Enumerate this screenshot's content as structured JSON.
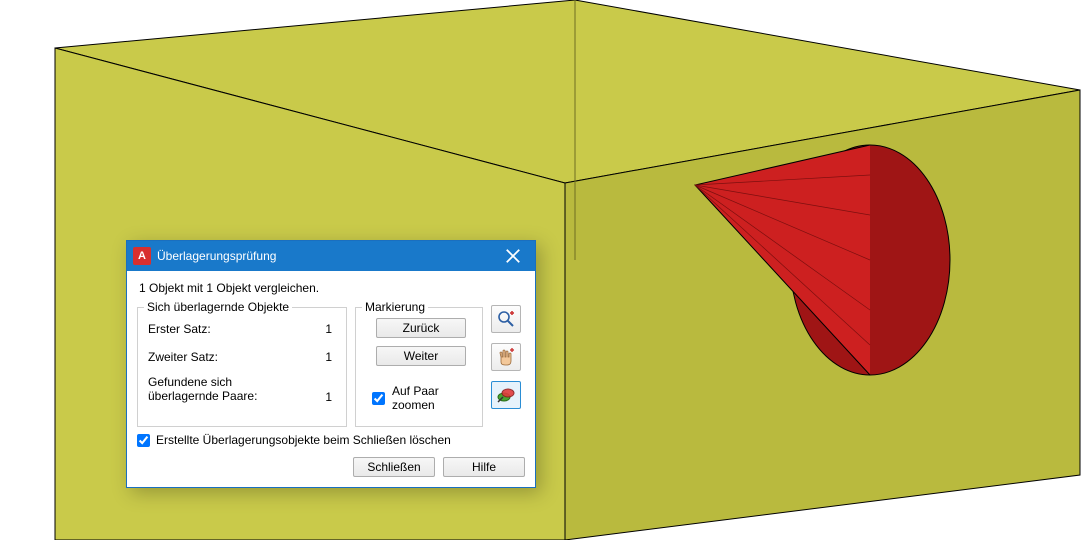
{
  "dialog": {
    "title": "Überlagerungsprüfung",
    "app_icon_letter": "A",
    "status": "1 Objekt mit 1 Objekt vergleichen.",
    "group_overlap": {
      "legend": "Sich überlagernde Objekte",
      "row1": {
        "label": "Erster Satz:",
        "value": "1"
      },
      "row2": {
        "label": "Zweiter Satz:",
        "value": "1"
      },
      "row3": {
        "label": "Gefundene sich\nüberlagernde Paare:",
        "value": "1"
      }
    },
    "group_mark": {
      "legend": "Markierung",
      "back": "Zurück",
      "next": "Weiter",
      "zoom_pair": "Auf Paar zoomen"
    },
    "delete_on_close": "Erstellte Überlagerungsobjekte beim Schließen löschen",
    "close": "Schließen",
    "help": "Hilfe"
  }
}
